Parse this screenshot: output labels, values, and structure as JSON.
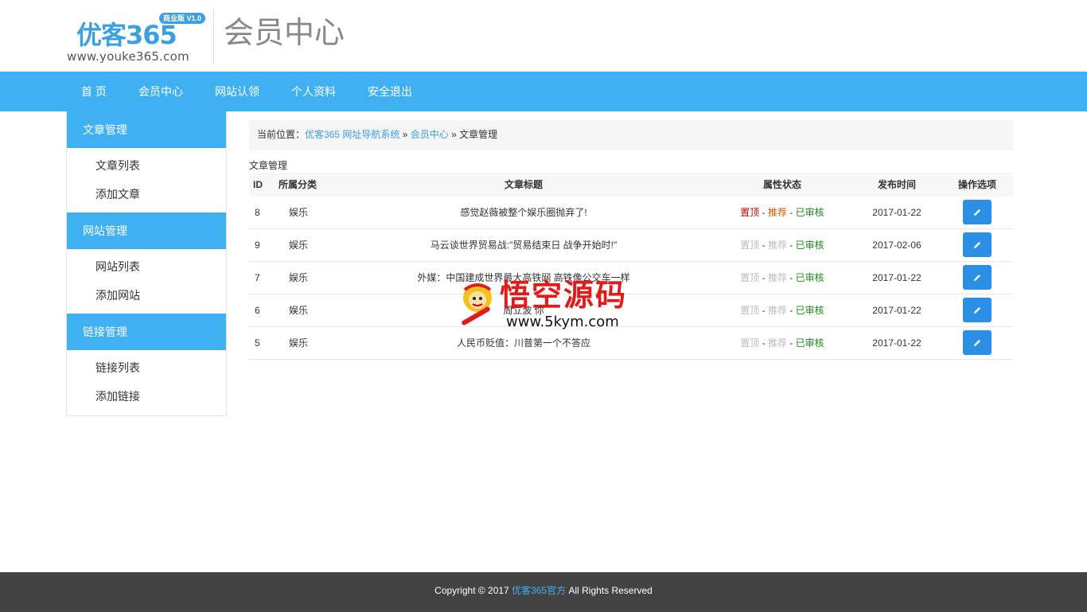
{
  "header": {
    "logo_text": "优客365",
    "logo_badge": "商业版 V1.0",
    "logo_url": "www.youke365.com",
    "title": "会员中心"
  },
  "nav": {
    "items": [
      {
        "label": "首 页"
      },
      {
        "label": "会员中心"
      },
      {
        "label": "网站认领"
      },
      {
        "label": "个人资料"
      },
      {
        "label": "安全退出"
      }
    ]
  },
  "sidebar": {
    "groups": [
      {
        "title": "文章管理",
        "links": [
          "文章列表",
          "添加文章"
        ]
      },
      {
        "title": "网站管理",
        "links": [
          "网站列表",
          "添加网站"
        ]
      },
      {
        "title": "链接管理",
        "links": [
          "链接列表",
          "添加链接"
        ]
      }
    ]
  },
  "breadcrumb": {
    "prefix": "当前位置：",
    "site": "优客365 网址导航系统",
    "sep1": " » ",
    "member": "会员中心",
    "sep2": " » ",
    "current": "文章管理"
  },
  "section_title": "文章管理",
  "table": {
    "headers": {
      "id": "ID",
      "category": "所属分类",
      "title": "文章标题",
      "status": "属性状态",
      "date": "发布时间",
      "actions": "操作选项"
    },
    "rows": [
      {
        "id": "8",
        "category": "娱乐",
        "title": "感觉赵薇被整个娱乐圈抛弃了!",
        "top": "置顶",
        "rec": "推荐",
        "audit": "已审核",
        "date": "2017-01-22",
        "top_active": true,
        "rec_active": true
      },
      {
        "id": "9",
        "category": "娱乐",
        "title": "马云谈世界贸易战:\"贸易结束日 战争开始时!\"",
        "top": "置顶",
        "rec": "推荐",
        "audit": "已审核",
        "date": "2017-02-06",
        "top_active": false,
        "rec_active": false
      },
      {
        "id": "7",
        "category": "娱乐",
        "title": "外媒：中国建成世界最大高铁网 高铁像公交车一样",
        "top": "置顶",
        "rec": "推荐",
        "audit": "已审核",
        "date": "2017-01-22",
        "top_active": false,
        "rec_active": false
      },
      {
        "id": "6",
        "category": "娱乐",
        "title": "周立波 你",
        "top": "置顶",
        "rec": "推荐",
        "audit": "已审核",
        "date": "2017-01-22",
        "top_active": false,
        "rec_active": false
      },
      {
        "id": "5",
        "category": "娱乐",
        "title": "人民币贬值：川普第一个不答应",
        "top": "置顶",
        "rec": "推荐",
        "audit": "已审核",
        "date": "2017-01-22",
        "top_active": false,
        "rec_active": false
      }
    ],
    "separator": " - "
  },
  "watermark": {
    "text": "悟空源码",
    "url": "www.5kym.com"
  },
  "footer": {
    "prefix": "Copyright © 2017 ",
    "link": "优客365官方",
    "suffix": " All Rights Reserved"
  },
  "colors": {
    "accent": "#3fb1f2",
    "button": "#2b8fe6",
    "status_red": "#c40000",
    "status_orange": "#e05a00",
    "status_green": "#1a8a1a",
    "footer_bg": "#434343"
  },
  "icons": {
    "edit": "pencil-icon"
  }
}
